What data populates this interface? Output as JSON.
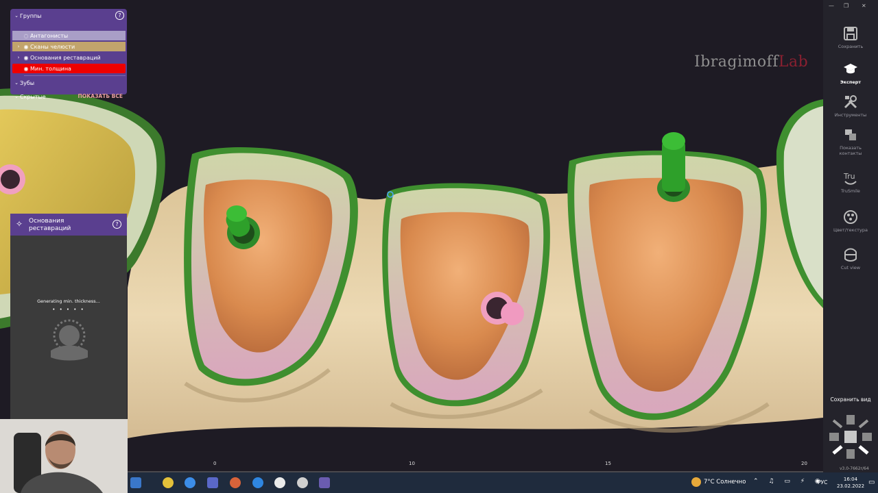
{
  "groups_panel": {
    "title": "Группы",
    "help": "?",
    "items": [
      {
        "label": "Антагонисты"
      },
      {
        "label": "Сканы челюсти"
      },
      {
        "label": "Основания реставраций"
      },
      {
        "label": "Мин. толщина"
      }
    ],
    "teeth": "Зубы",
    "hidden": "Скрытые",
    "show_all": "ПОКАЗАТЬ ВСЕ"
  },
  "bases_panel": {
    "title": "Основания реставраций",
    "help": "?",
    "status": "Generating min. thickness...",
    "dots": "• • • • •"
  },
  "logo": {
    "part1": "Ibragimoff",
    "part2": "Lab"
  },
  "ruler": [
    "0",
    "10",
    "15",
    "20"
  ],
  "toolbar": {
    "buttons": [
      {
        "label": "Сохранить",
        "icon": "save-icon"
      },
      {
        "label": "Эксперт",
        "icon": "expert-icon"
      },
      {
        "label": "Инструменты",
        "icon": "tools-icon"
      },
      {
        "label": "Показать контакты",
        "icon": "contacts-icon"
      },
      {
        "label": "TruSmile",
        "icon": "trusmile-icon"
      },
      {
        "label": "Цвет/текстура",
        "icon": "color-texture-icon"
      },
      {
        "label": "Cut view",
        "icon": "cut-view-icon"
      }
    ],
    "save_view": "Сохранить вид",
    "version": "v3.0-7662r/64"
  },
  "taskbar": {
    "weather": "7°C Солнечно",
    "lang": "РУС",
    "time": "16:04",
    "date": "23.02.2022"
  },
  "colors": {
    "accent": "#5a3f8f",
    "warning": "#e00000",
    "gum": "#e8d2a8",
    "crown": "#c97a3f",
    "margin": "#3f8f2f"
  }
}
